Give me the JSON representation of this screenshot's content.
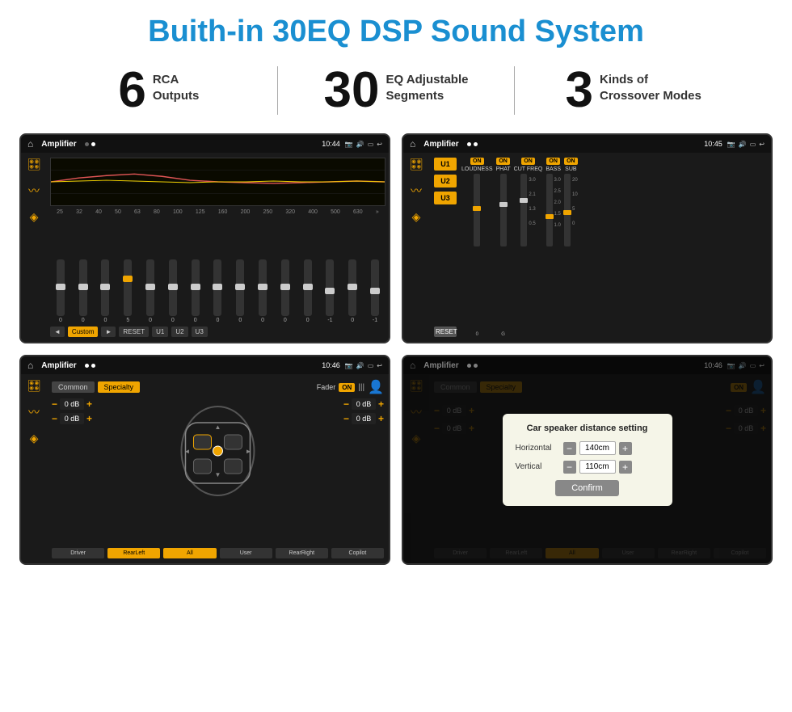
{
  "header": {
    "title": "Buith-in 30EQ DSP Sound System"
  },
  "stats": [
    {
      "number": "6",
      "label": "RCA\nOutputs"
    },
    {
      "number": "30",
      "label": "EQ Adjustable\nSegments"
    },
    {
      "number": "3",
      "label": "Kinds of\nCrossover Modes"
    }
  ],
  "screens": [
    {
      "id": "eq-screen",
      "title": "Amplifier",
      "time": "10:44",
      "type": "eq"
    },
    {
      "id": "crossover-screen",
      "title": "Amplifier",
      "time": "10:45",
      "type": "crossover"
    },
    {
      "id": "fader-screen",
      "title": "Amplifier",
      "time": "10:46",
      "type": "fader"
    },
    {
      "id": "dialog-screen",
      "title": "Amplifier",
      "time": "10:46",
      "type": "dialog"
    }
  ],
  "eq": {
    "frequencies": [
      "25",
      "32",
      "40",
      "50",
      "63",
      "80",
      "100",
      "125",
      "160",
      "200",
      "250",
      "320",
      "400",
      "500",
      "630"
    ],
    "values": [
      "0",
      "0",
      "0",
      "5",
      "0",
      "0",
      "0",
      "0",
      "0",
      "0",
      "0",
      "0",
      "-1",
      "0",
      "-1"
    ],
    "preset": "Custom",
    "buttons": [
      "◄",
      "Custom",
      "►",
      "RESET",
      "U1",
      "U2",
      "U3"
    ]
  },
  "crossover": {
    "presets": [
      "U1",
      "U2",
      "U3"
    ],
    "channels": [
      {
        "name": "LOUDNESS",
        "on": true
      },
      {
        "name": "PHAT",
        "on": true
      },
      {
        "name": "CUT FREQ",
        "on": true
      },
      {
        "name": "BASS",
        "on": true
      },
      {
        "name": "SUB",
        "on": true
      }
    ],
    "reset": "RESET"
  },
  "fader": {
    "tabs": [
      "Common",
      "Specialty"
    ],
    "activeTab": "Specialty",
    "faderLabel": "Fader",
    "onLabel": "ON",
    "buttons": [
      "Driver",
      "RearLeft",
      "All",
      "User",
      "RearRight",
      "Copilot"
    ],
    "dbValues": [
      "0 dB",
      "0 dB",
      "0 dB",
      "0 dB"
    ]
  },
  "dialog": {
    "title": "Car speaker distance setting",
    "horizontal": {
      "label": "Horizontal",
      "value": "140cm"
    },
    "vertical": {
      "label": "Vertical",
      "value": "110cm"
    },
    "confirmLabel": "Confirm",
    "dbValues": [
      "0 dB",
      "0 dB"
    ],
    "tabs": [
      "Common",
      "Specialty"
    ]
  }
}
